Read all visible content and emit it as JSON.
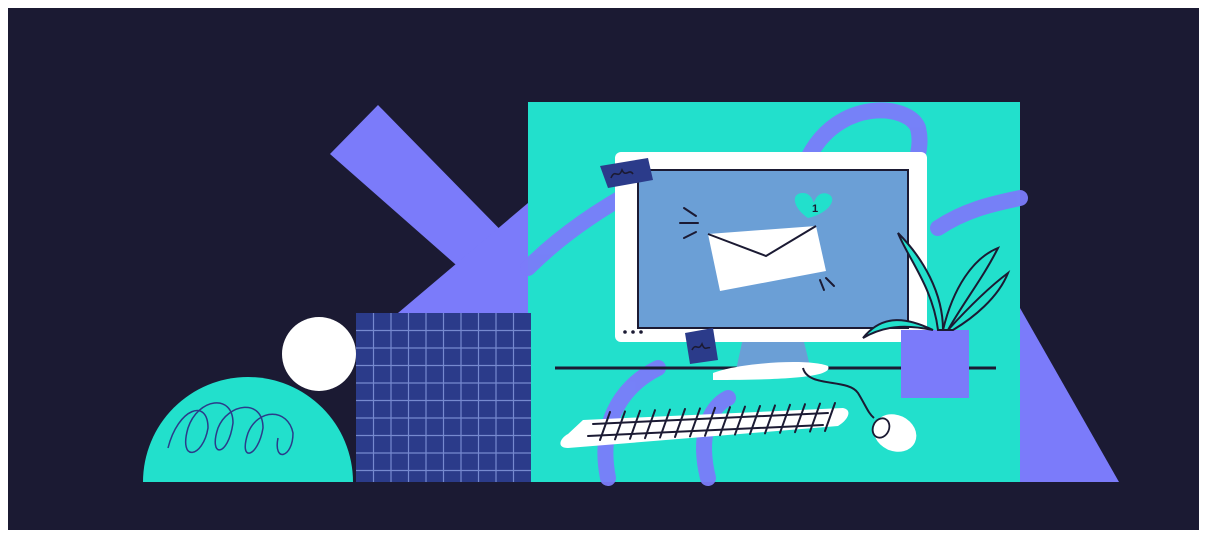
{
  "illustration": {
    "subject": "computer",
    "notification_badge": "1",
    "colors": {
      "background": "#1b1a33",
      "teal": "#22e0cc",
      "purple": "#7b7bfa",
      "navy": "#2b3b8a",
      "screen": "#6b9fd6",
      "white": "#ffffff",
      "ink": "#1b1a33"
    }
  }
}
